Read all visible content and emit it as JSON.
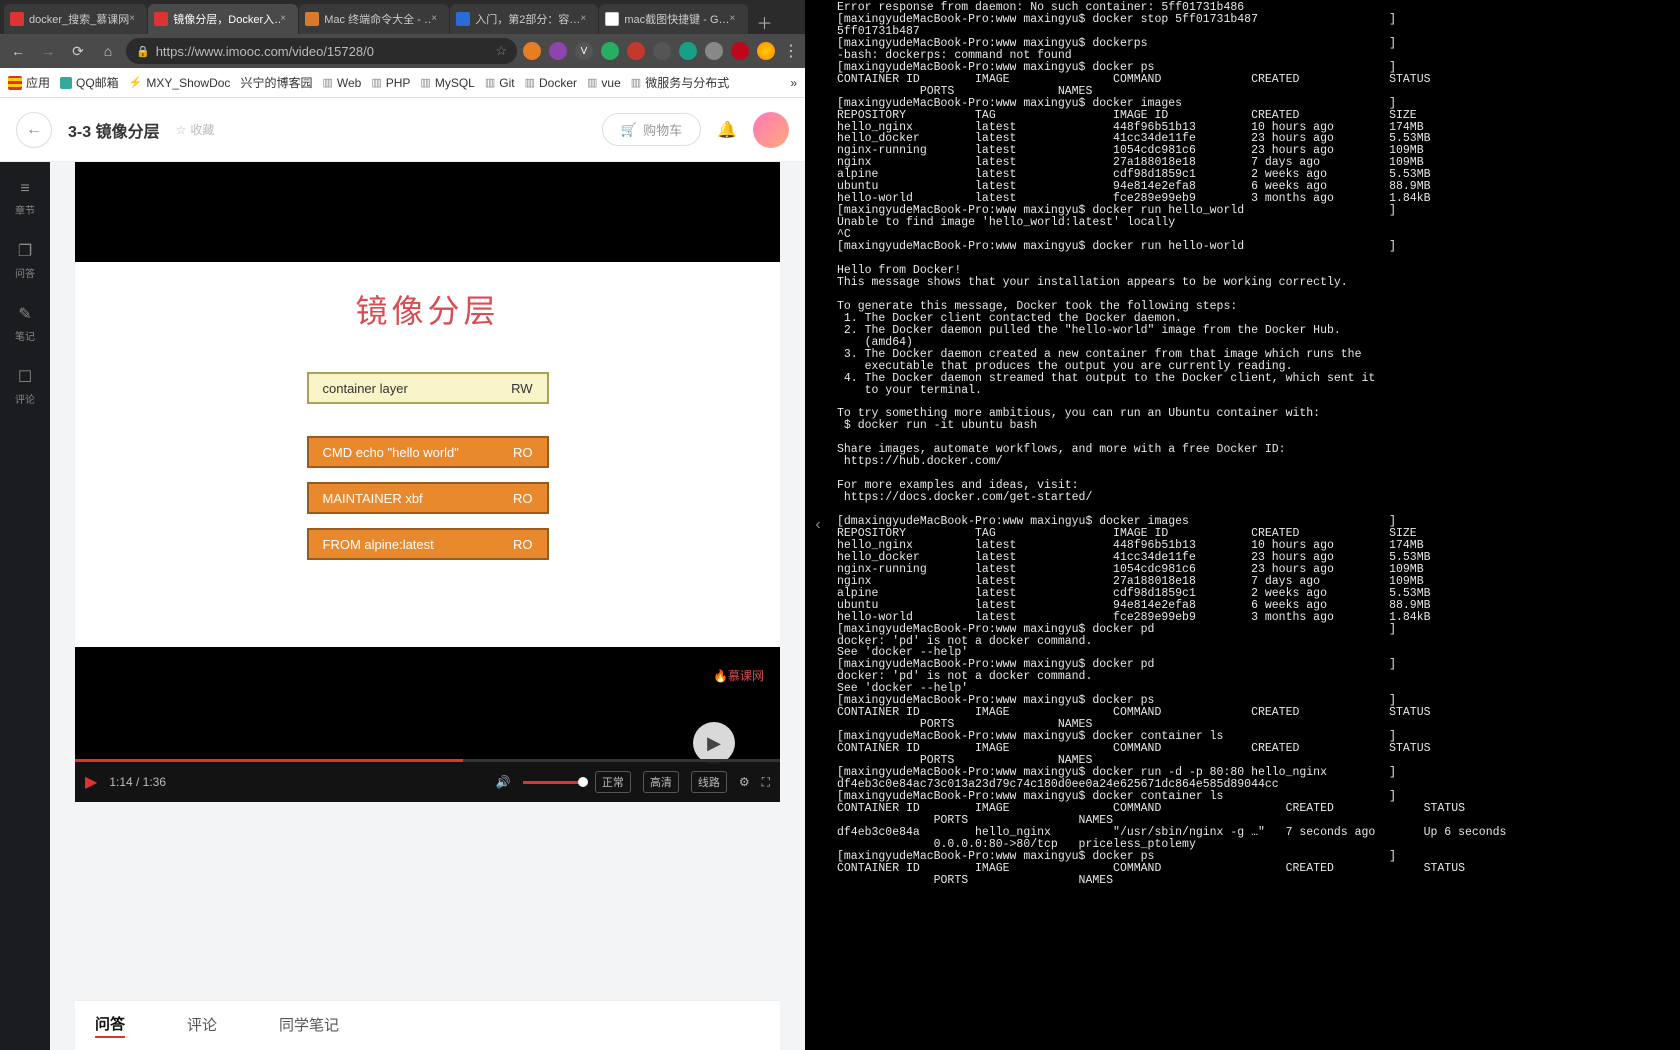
{
  "chrome": {
    "tabs": [
      {
        "label": "docker_搜索_慕课网",
        "icon": "imooc",
        "active": false
      },
      {
        "label": "镜像分层，Docker入…",
        "icon": "imooc",
        "active": true
      },
      {
        "label": "Mac 终端命令大全 - …",
        "icon": "jian",
        "active": false
      },
      {
        "label": "入门，第2部分：容…",
        "icon": "ibm",
        "active": false
      },
      {
        "label": "mac截图快捷键 - G…",
        "icon": "g",
        "active": false
      }
    ],
    "url": "https://www.imooc.com/video/15728/0",
    "bookmarks_app": "应用",
    "bookmarks": [
      "QQ邮箱",
      "MXY_ShowDoc",
      "兴宁的博客园",
      "Web",
      "PHP",
      "MySQL",
      "Git",
      "Docker",
      "vue",
      "微服务与分布式"
    ]
  },
  "page": {
    "course_title": "3-3 镜像分层",
    "favorite": "收藏",
    "cart": "购物车",
    "rail": [
      {
        "icon": "≡",
        "label": "章节"
      },
      {
        "icon": "✎",
        "label": "问答"
      },
      {
        "icon": "✎",
        "label": "笔记"
      },
      {
        "icon": "☐",
        "label": "评论"
      }
    ],
    "slide": {
      "title": "镜像分层",
      "layers": [
        {
          "text": "container layer",
          "mode": "RW",
          "style": "yellow"
        },
        {
          "text": "CMD echo \"hello world\"",
          "mode": "RO",
          "style": "orange"
        },
        {
          "text": "MAINTAINER xbf",
          "mode": "RO",
          "style": "orange"
        },
        {
          "text": "FROM alpine:latest",
          "mode": "RO",
          "style": "orange"
        }
      ],
      "watermark": "慕课网"
    },
    "player": {
      "time": "1:14 / 1:36",
      "normal": "正常",
      "hd": "高清",
      "line": "线路"
    },
    "subtabs": [
      "问答",
      "评论",
      "同学笔记"
    ]
  },
  "terminal_text": "Error response from daemon: No such container: 5ff01731b486\n[maxingyudeMacBook-Pro:www maxingyu$ docker stop 5ff01731b487                   ]\n5ff01731b487\n[maxingyudeMacBook-Pro:www maxingyu$ dockerps                                   ]\n-bash: dockerps: command not found\n[maxingyudeMacBook-Pro:www maxingyu$ docker ps                                  ]\nCONTAINER ID        IMAGE               COMMAND             CREATED             STATUS\n            PORTS               NAMES\n[maxingyudeMacBook-Pro:www maxingyu$ docker images                              ]\nREPOSITORY          TAG                 IMAGE ID            CREATED             SIZE\nhello_nginx         latest              448f96b51b13        10 hours ago        174MB\nhello_docker        latest              41cc34de11fe        23 hours ago        5.53MB\nnginx-running       latest              1054cdc981c6        23 hours ago        109MB\nnginx               latest              27a188018e18        7 days ago          109MB\nalpine              latest              cdf98d1859c1        2 weeks ago         5.53MB\nubuntu              latest              94e814e2efa8        6 weeks ago         88.9MB\nhello-world         latest              fce289e99eb9        3 months ago        1.84kB\n[maxingyudeMacBook-Pro:www maxingyu$ docker run hello_world                     ]\nUnable to find image 'hello_world:latest' locally\n^C\n[maxingyudeMacBook-Pro:www maxingyu$ docker run hello-world                     ]\n\nHello from Docker!\nThis message shows that your installation appears to be working correctly.\n\nTo generate this message, Docker took the following steps:\n 1. The Docker client contacted the Docker daemon.\n 2. The Docker daemon pulled the \"hello-world\" image from the Docker Hub.\n    (amd64)\n 3. The Docker daemon created a new container from that image which runs the\n    executable that produces the output you are currently reading.\n 4. The Docker daemon streamed that output to the Docker client, which sent it\n    to your terminal.\n\nTo try something more ambitious, you can run an Ubuntu container with:\n $ docker run -it ubuntu bash\n\nShare images, automate workflows, and more with a free Docker ID:\n https://hub.docker.com/\n\nFor more examples and ideas, visit:\n https://docs.docker.com/get-started/\n\n[dmaxingyudeMacBook-Pro:www maxingyu$ docker images                             ]\nREPOSITORY          TAG                 IMAGE ID            CREATED             SIZE\nhello_nginx         latest              448f96b51b13        10 hours ago        174MB\nhello_docker        latest              41cc34de11fe        23 hours ago        5.53MB\nnginx-running       latest              1054cdc981c6        23 hours ago        109MB\nnginx               latest              27a188018e18        7 days ago          109MB\nalpine              latest              cdf98d1859c1        2 weeks ago         5.53MB\nubuntu              latest              94e814e2efa8        6 weeks ago         88.9MB\nhello-world         latest              fce289e99eb9        3 months ago        1.84kB\n[maxingyudeMacBook-Pro:www maxingyu$ docker pd                                  ]\ndocker: 'pd' is not a docker command.\nSee 'docker --help'\n[maxingyudeMacBook-Pro:www maxingyu$ docker pd                                  ]\ndocker: 'pd' is not a docker command.\nSee 'docker --help'\n[maxingyudeMacBook-Pro:www maxingyu$ docker ps                                  ]\nCONTAINER ID        IMAGE               COMMAND             CREATED             STATUS\n            PORTS               NAMES\n[maxingyudeMacBook-Pro:www maxingyu$ docker container ls                        ]\nCONTAINER ID        IMAGE               COMMAND             CREATED             STATUS\n            PORTS               NAMES\n[maxingyudeMacBook-Pro:www maxingyu$ docker run -d -p 80:80 hello_nginx         ]\ndf4eb3c0e84ac73c013a23d79c74c180d0ee0a24e625671dc864e585d89044cc\n[maxingyudeMacBook-Pro:www maxingyu$ docker container ls                        ]\nCONTAINER ID        IMAGE               COMMAND                  CREATED             STATUS\n              PORTS                NAMES\ndf4eb3c0e84a        hello_nginx         \"/usr/sbin/nginx -g …\"   7 seconds ago       Up 6 seconds\n              0.0.0.0:80->80/tcp   priceless_ptolemy\n[maxingyudeMacBook-Pro:www maxingyu$ docker ps                                  ]\nCONTAINER ID        IMAGE               COMMAND                  CREATED             STATUS\n              PORTS                NAMES"
}
